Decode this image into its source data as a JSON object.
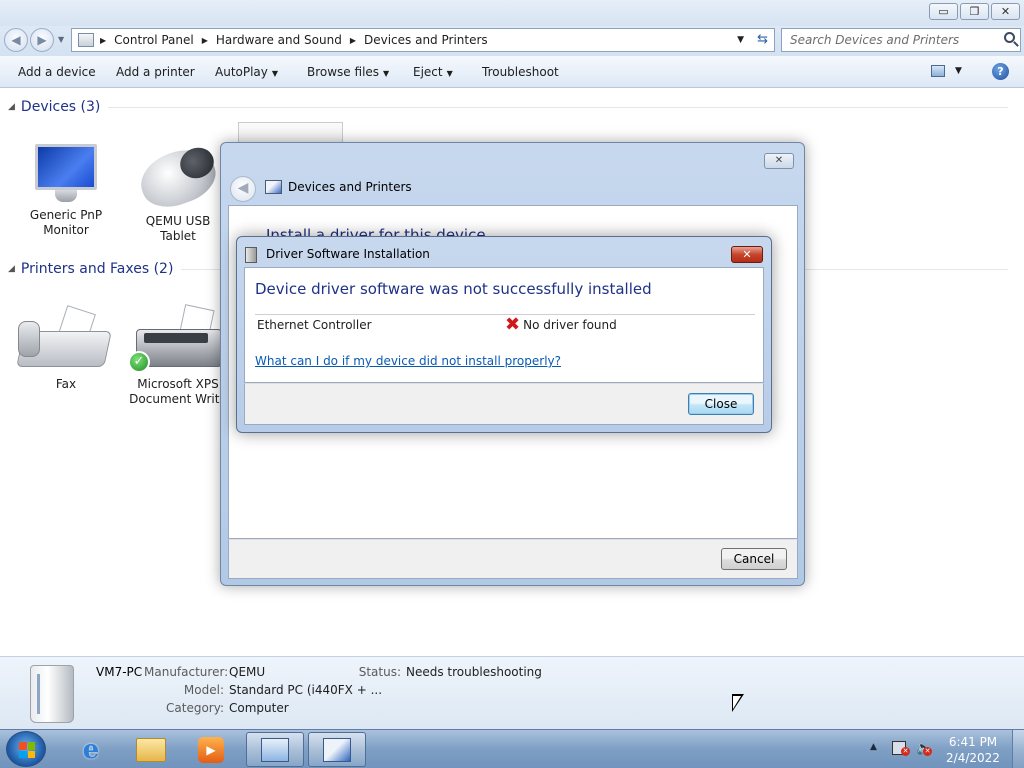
{
  "window": {
    "minimize_glyph": "▭",
    "maximize_glyph": "❐",
    "close_glyph": "✕"
  },
  "address": {
    "crumbs": [
      "Control Panel",
      "Hardware and Sound",
      "Devices and Printers"
    ],
    "search_placeholder": "Search Devices and Printers"
  },
  "toolbar": {
    "add_device": "Add a device",
    "add_printer": "Add a printer",
    "autoplay": "AutoPlay",
    "browse_files": "Browse files",
    "eject": "Eject",
    "troubleshoot": "Troubleshoot",
    "help_glyph": "?"
  },
  "groups": {
    "devices": {
      "label": "Devices (3)",
      "items": [
        {
          "label_line1": "Generic PnP",
          "label_line2": "Monitor",
          "icon": "monitor-icon"
        },
        {
          "label_line1": "QEMU USB",
          "label_line2": "Tablet",
          "icon": "mouse-icon"
        }
      ]
    },
    "printers": {
      "label": "Printers and Faxes (2)",
      "items": [
        {
          "label_line1": "Fax",
          "label_line2": "",
          "icon": "fax-icon"
        },
        {
          "label_line1": "Microsoft XPS",
          "label_line2": "Document Write",
          "icon": "printer-icon"
        }
      ]
    }
  },
  "dp_dialog": {
    "title": "Devices and Printers",
    "heading": "Install a driver for this device",
    "cancel_label": "Cancel"
  },
  "dsi_dialog": {
    "title": "Driver Software Installation",
    "heading": "Device driver software was not successfully installed",
    "device_name": "Ethernet Controller",
    "status": "No driver found",
    "help_link": "What can I do if my device did not install properly?",
    "close_label": "Close"
  },
  "details": {
    "name": "VM7-PC",
    "manufacturer_label": "Manufacturer:",
    "manufacturer_value": "QEMU",
    "model_label": "Model:",
    "model_value": "Standard PC (i440FX + ...",
    "category_label": "Category:",
    "category_value": "Computer",
    "status_label": "Status:",
    "status_value": "Needs troubleshooting"
  },
  "taskbar": {
    "time": "6:41 PM",
    "date": "2/4/2022"
  },
  "colors": {
    "accent_heading": "#1e3287",
    "link": "#0a5ab4",
    "error": "#d01818",
    "taskbar": "#7f9fc4"
  }
}
